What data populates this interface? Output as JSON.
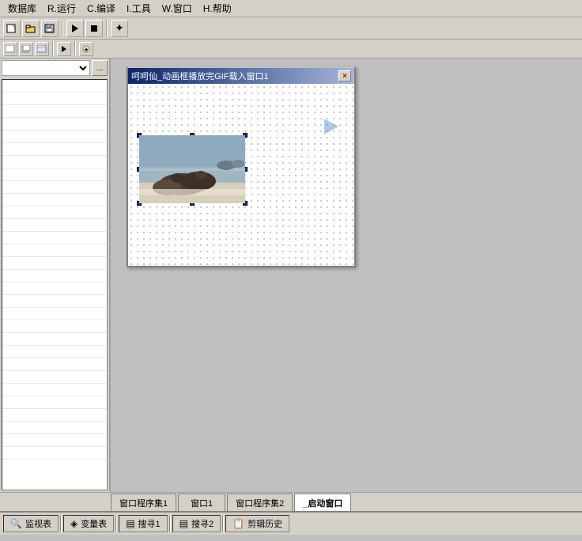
{
  "menubar": {
    "items": [
      {
        "id": "database",
        "label": "数据库"
      },
      {
        "id": "run",
        "label": "R.运行"
      },
      {
        "id": "compile",
        "label": "C.编译"
      },
      {
        "id": "tools",
        "label": "I.工具"
      },
      {
        "id": "window",
        "label": "W.窗口"
      },
      {
        "id": "help",
        "label": "H.帮助"
      }
    ]
  },
  "toolbar1": {
    "buttons": [
      {
        "id": "new",
        "icon": "new-icon",
        "shape": "page"
      },
      {
        "id": "open",
        "icon": "open-icon",
        "shape": "folder"
      },
      {
        "id": "save",
        "icon": "save-icon",
        "shape": "save"
      },
      {
        "id": "play",
        "icon": "play-icon",
        "shape": "play"
      },
      {
        "id": "stop",
        "icon": "stop-icon",
        "shape": "stop"
      },
      {
        "id": "star",
        "icon": "star-icon",
        "shape": "star"
      }
    ]
  },
  "inner_window": {
    "title": "呵呵仙_动画框播放完GIF载入窗口1",
    "close_label": "×"
  },
  "tabs": [
    {
      "id": "tab1",
      "label": "窗口程序集1",
      "active": false
    },
    {
      "id": "tab2",
      "label": "窗口1",
      "active": false
    },
    {
      "id": "tab3",
      "label": "窗口程序集2",
      "active": false
    },
    {
      "id": "tab4",
      "label": "_启动窗口",
      "active": true
    }
  ],
  "statusbar": {
    "items": [
      {
        "id": "monitor",
        "icon": "monitor-icon",
        "label": "监视表"
      },
      {
        "id": "variables",
        "icon": "variable-icon",
        "label": "变量表"
      },
      {
        "id": "search1",
        "icon": "search-icon",
        "label": "搜寻1"
      },
      {
        "id": "search2",
        "icon": "search2-icon",
        "label": "搜寻2"
      },
      {
        "id": "clipboard",
        "icon": "clipboard-icon",
        "label": "剪辑历史"
      }
    ]
  },
  "sidebar": {
    "dropdown_value": "",
    "btn_label": "..."
  }
}
